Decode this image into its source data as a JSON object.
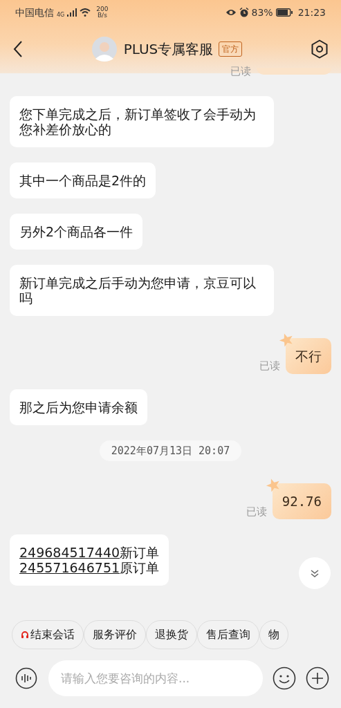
{
  "status_bar": {
    "carrier": "中国电信",
    "network": "4G",
    "speed": "200",
    "speed_unit": "B/s",
    "battery": "83%",
    "time": "21:23"
  },
  "header": {
    "title": "PLUS专属客服",
    "tag": "官方"
  },
  "top_receipt": "已读",
  "messages": [
    {
      "kind": "agent",
      "text": "您下单完成之后，新订单签收了会手动为您补差价放心的"
    },
    {
      "kind": "agent",
      "text": "其中一个商品是2件的"
    },
    {
      "kind": "agent",
      "text": "另外2个商品各一件"
    },
    {
      "kind": "agent",
      "text": "新订单完成之后手动为您申请，京豆可以吗"
    },
    {
      "kind": "user",
      "text": "不行",
      "receipt": "已读"
    },
    {
      "kind": "agent",
      "text": "那之后为您申请余额"
    },
    {
      "kind": "time",
      "text": "2022年07月13日  20:07"
    },
    {
      "kind": "user",
      "text": "92.76",
      "receipt": "已读",
      "mono": true
    },
    {
      "kind": "orders",
      "lines": [
        {
          "number": "249684517440",
          "label": "新订单"
        },
        {
          "number": "245571646751",
          "label": "原订单"
        }
      ]
    }
  ],
  "quick_replies": [
    {
      "label": "结束会话",
      "kind": "end"
    },
    {
      "label": "服务评价",
      "kind": "plain"
    },
    {
      "label": "退换货",
      "kind": "plain"
    },
    {
      "label": "售后查询",
      "kind": "plain"
    },
    {
      "label": "物",
      "kind": "plain"
    }
  ],
  "input": {
    "placeholder": "请输入您要咨询的内容..."
  }
}
